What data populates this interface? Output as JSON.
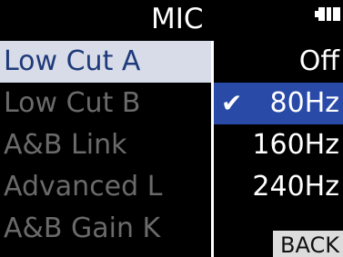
{
  "header": {
    "title": "MIC",
    "battery_icon": "battery-icon"
  },
  "left_menu": {
    "items": [
      {
        "label": "Low Cut A",
        "selected": true
      },
      {
        "label": "Low Cut B",
        "selected": false
      },
      {
        "label": "A&B Link",
        "selected": false
      },
      {
        "label": "Advanced L",
        "selected": false
      },
      {
        "label": "A&B Gain K",
        "selected": false
      }
    ]
  },
  "options": {
    "items": [
      {
        "label": "Off",
        "selected": false
      },
      {
        "label": "80Hz",
        "selected": true,
        "check": "✔"
      },
      {
        "label": "160Hz",
        "selected": false
      },
      {
        "label": "240Hz",
        "selected": false
      }
    ]
  },
  "footer": {
    "back_label": "BACK"
  },
  "colors": {
    "background": "#000000",
    "menu_selected_bg": "#d7dce8",
    "menu_selected_text": "#1f3a7a",
    "option_selected_bg": "#2a4aa8",
    "dim_text": "#6a6a6a"
  }
}
